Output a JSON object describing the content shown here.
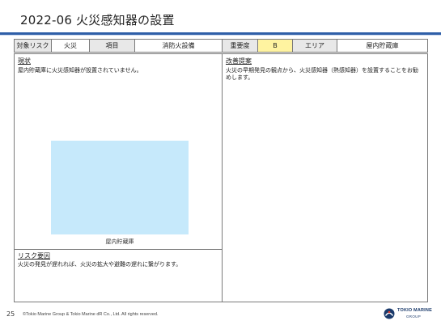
{
  "title": "2022-06 火災感知器の設置",
  "header": {
    "target_risk_label": "対象リスク",
    "target_risk_value": "火災",
    "item_label": "項目",
    "item_value": "消防火設備",
    "priority_label": "重要度",
    "priority_value": "B",
    "area_label": "エリア",
    "area_value": "屋内貯蔵庫"
  },
  "current": {
    "label": "現状",
    "text": "屋内貯蔵庫に火災感知器が設置されていません。",
    "photo_caption": "屋内貯蔵庫"
  },
  "risk_factor": {
    "label": "リスク要因",
    "text": "火災の発見が遅れれば、火災の拡大や避難の遅れに繋がります。"
  },
  "proposal": {
    "label": "改善提案",
    "text": "火災の早期発見の観点から、火災感知器（熱感知器）を設置することをお勧めします。"
  },
  "footer": {
    "page_number": "25",
    "copyright": "©Tokio Marine Group & Tokio Marine dR Co., Ltd. All rights reserved.",
    "logo_line1": "TOKIO MARINE",
    "logo_line2": "GROUP"
  },
  "colors": {
    "accent": "#2f5fa8",
    "priority_bg": "#fff3a0",
    "label_bg": "#e8e8e8",
    "photo_placeholder": "#c6e9fb"
  }
}
